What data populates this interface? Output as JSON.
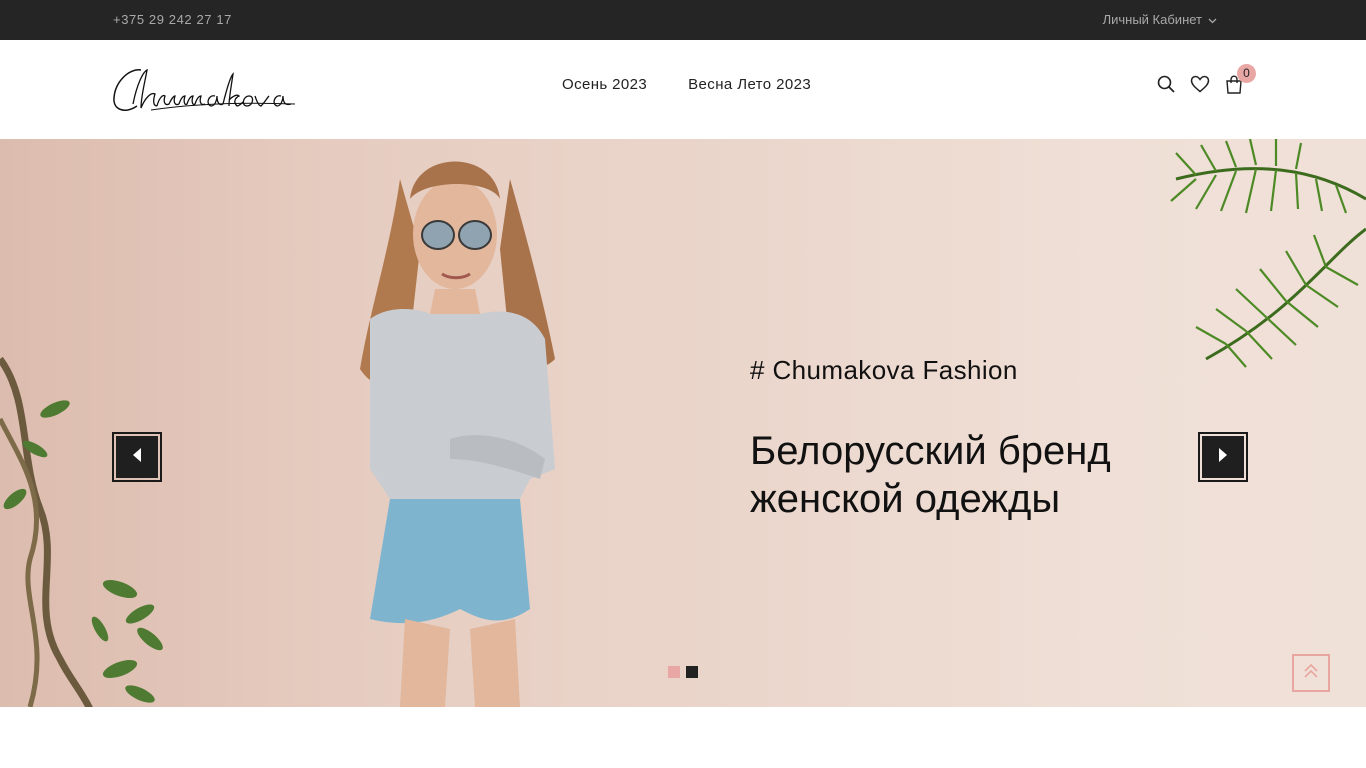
{
  "topbar": {
    "phone": "+375 29 242 27 17",
    "account_label": "Личный Кабинет"
  },
  "header": {
    "logo_text": "Chumakova",
    "nav": [
      {
        "label": "Осень 2023"
      },
      {
        "label": "Весна Лето 2023"
      }
    ],
    "cart_count": "0"
  },
  "hero": {
    "tagline": "# Chumakova Fashion",
    "headline_line1": "Белорусский бренд",
    "headline_line2": "женской одежды",
    "dots": [
      {
        "active": true
      },
      {
        "active": false
      }
    ]
  },
  "colors": {
    "topbar_bg": "#252525",
    "accent_pink": "#e8a7a4",
    "dark": "#1f1f1f"
  }
}
